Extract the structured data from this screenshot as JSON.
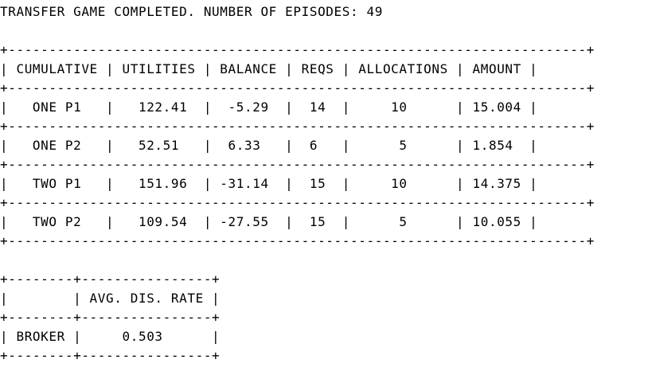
{
  "header": {
    "text": "TRANSFER GAME COMPLETED. NUMBER OF EPISODES: 49"
  },
  "results_table": {
    "lines": [
      "+-----------------------------------------------------------------------+",
      "| CUMULATIVE | UTILITIES | BALANCE | REQS | ALLOCATIONS | AMOUNT |",
      "+-----------------------------------------------------------------------+",
      "|   ONE P1   |   122.41  |  -5.29  |  14  |     10      | 15.004 |",
      "+-----------------------------------------------------------------------+",
      "|   ONE P2   |   52.51   |  6.33   |  6   |      5      | 1.854  |",
      "+-----------------------------------------------------------------------+",
      "|   TWO P1   |   151.96  | -31.14  |  15  |     10      | 14.375 |",
      "+-----------------------------------------------------------------------+",
      "|   TWO P2   |   109.54  | -27.55  |  15  |      5      | 10.055 |",
      "+-----------------------------------------------------------------------+"
    ]
  },
  "broker_table": {
    "lines": [
      "+--------+----------------+",
      "|        | AVG. DIS. RATE |",
      "+--------+----------------+",
      "| BROKER |     0.503      |",
      "+--------+----------------+"
    ]
  }
}
